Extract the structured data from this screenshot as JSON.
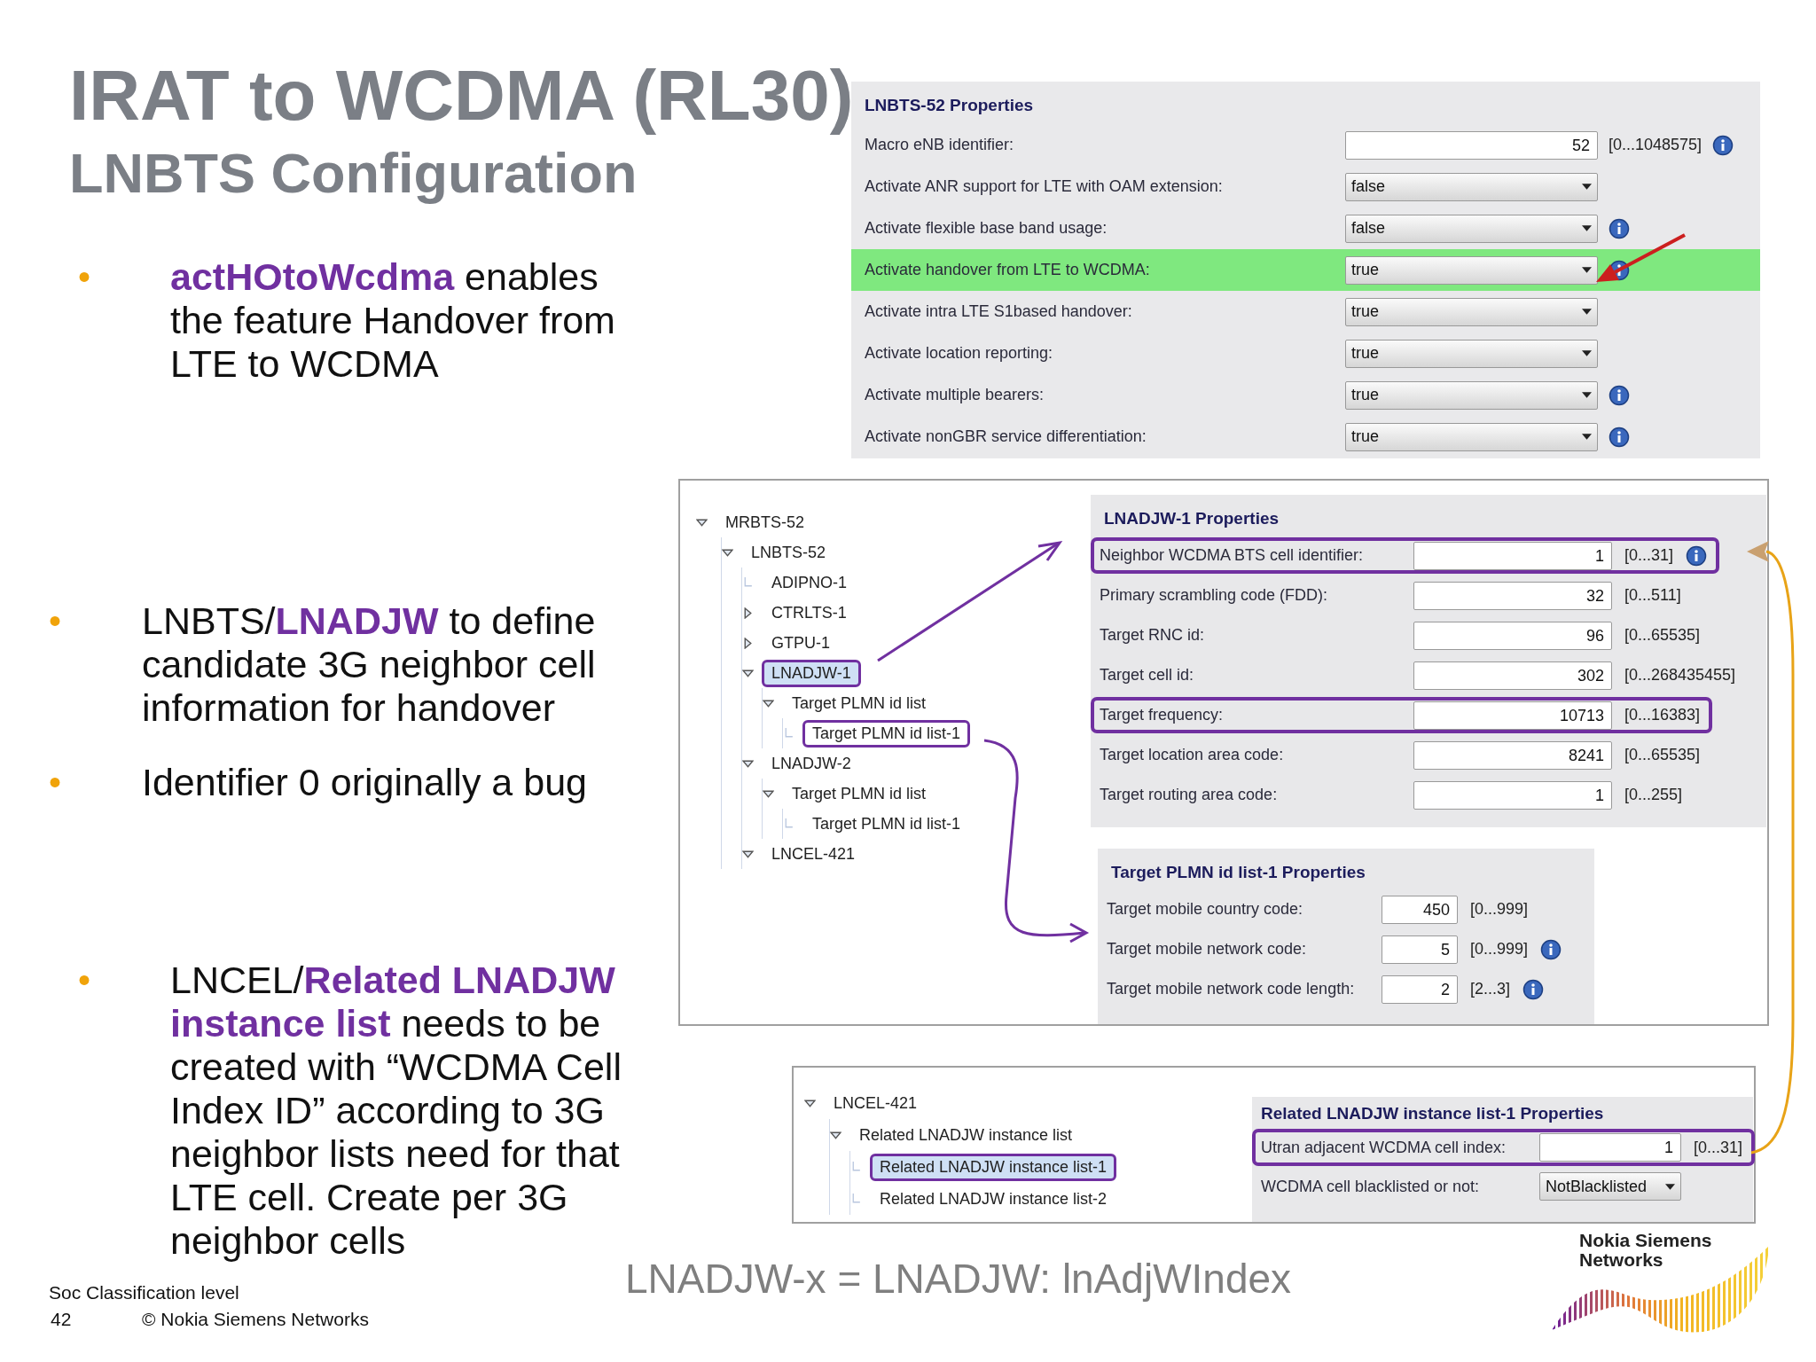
{
  "slide": {
    "title": "IRAT to WCDMA (RL30)",
    "subtitle": "LNBTS Configuration",
    "bullets": [
      {
        "marker": "•",
        "text": "**actHOtoWcdma** enables the feature Handover from LTE to WCDMA"
      },
      {
        "marker": "•",
        "text": "LNBTS/**LNADJW** to define candidate 3G neighbor cell information for handover"
      },
      {
        "marker": "•",
        "text": "Identifier 0 originally a bug"
      },
      {
        "marker": "•",
        "text": "LNCEL/**Related LNADJW instance list** needs to be created with “WCDMA Cell Index ID” according to 3G neighbor lists need for that LTE cell. Create per 3G neighbor cells"
      }
    ],
    "caption": "LNADJW-x = LNADJW: lnAdjWIndex",
    "footer": {
      "classification": "Soc Classification level",
      "page": "42",
      "copyright": "© Nokia Siemens Networks"
    },
    "logo": "Nokia Siemens Networks"
  },
  "lnbts_panel": {
    "title": "LNBTS-52 Properties",
    "rows": [
      {
        "label": "Macro eNB identifier:",
        "kind": "text",
        "value": "52",
        "range": "[0...1048575]",
        "info": true,
        "highlighted": false
      },
      {
        "label": "Activate ANR support for LTE with OAM extension:",
        "kind": "select",
        "value": "false",
        "info": false,
        "highlighted": false
      },
      {
        "label": "Activate flexible base band usage:",
        "kind": "select",
        "value": "false",
        "info": true,
        "highlighted": false
      },
      {
        "label": "Activate handover from LTE to WCDMA:",
        "kind": "select",
        "value": "true",
        "info": true,
        "highlighted": true
      },
      {
        "label": "Activate intra LTE S1based handover:",
        "kind": "select",
        "value": "true",
        "info": false,
        "highlighted": false
      },
      {
        "label": "Activate location reporting:",
        "kind": "select",
        "value": "true",
        "info": false,
        "highlighted": false
      },
      {
        "label": "Activate multiple bearers:",
        "kind": "select",
        "value": "true",
        "info": true,
        "highlighted": false
      },
      {
        "label": "Activate nonGBR service differentiation:",
        "kind": "select",
        "value": "true",
        "info": true,
        "highlighted": false
      }
    ]
  },
  "lnadjw_view": {
    "tree": [
      {
        "label": "MRBTS-52",
        "kind": "node",
        "expanded": true,
        "selected": false,
        "outlined": false,
        "children": [
          {
            "label": "LNBTS-52",
            "kind": "node",
            "expanded": true,
            "selected": false,
            "outlined": false,
            "children": [
              {
                "label": "ADIPNO-1",
                "kind": "leaf",
                "selected": false,
                "outlined": false
              },
              {
                "label": "CTRLTS-1",
                "kind": "node",
                "expanded": false,
                "selected": false,
                "outlined": false
              },
              {
                "label": "GTPU-1",
                "kind": "node",
                "expanded": false,
                "selected": false,
                "outlined": false
              },
              {
                "label": "LNADJW-1",
                "kind": "node",
                "expanded": true,
                "selected": true,
                "outlined": true,
                "children": [
                  {
                    "label": "Target PLMN id list",
                    "kind": "node",
                    "expanded": true,
                    "selected": false,
                    "outlined": false,
                    "children": [
                      {
                        "label": "Target PLMN id list-1",
                        "kind": "leaf",
                        "selected": false,
                        "outlined": true
                      }
                    ]
                  }
                ]
              },
              {
                "label": "LNADJW-2",
                "kind": "node",
                "expanded": true,
                "selected": false,
                "outlined": false,
                "children": [
                  {
                    "label": "Target PLMN id list",
                    "kind": "node",
                    "expanded": true,
                    "selected": false,
                    "outlined": false,
                    "children": [
                      {
                        "label": "Target PLMN id list-1",
                        "kind": "leaf",
                        "selected": false,
                        "outlined": false
                      }
                    ]
                  }
                ]
              },
              {
                "label": "LNCEL-421",
                "kind": "node",
                "expanded": true,
                "selected": false,
                "outlined": false
              }
            ]
          }
        ]
      }
    ],
    "properties": {
      "title": "LNADJW-1 Properties",
      "rows": [
        {
          "label": "Neighbor WCDMA BTS cell identifier:",
          "kind": "text",
          "value": "1",
          "range": "[0...31]",
          "info": true,
          "outlined": true
        },
        {
          "label": "Primary scrambling code (FDD):",
          "kind": "text",
          "value": "32",
          "range": "[0...511]",
          "info": false,
          "outlined": false
        },
        {
          "label": "Target RNC id:",
          "kind": "text",
          "value": "96",
          "range": "[0...65535]",
          "info": false,
          "outlined": false
        },
        {
          "label": "Target cell id:",
          "kind": "text",
          "value": "302",
          "range": "[0...268435455]",
          "info": false,
          "outlined": false
        },
        {
          "label": "Target frequency:",
          "kind": "text",
          "value": "10713",
          "range": "[0...16383]",
          "info": false,
          "outlined": true
        },
        {
          "label": "Target location area code:",
          "kind": "text",
          "value": "8241",
          "range": "[0...65535]",
          "info": false,
          "outlined": false
        },
        {
          "label": "Target routing area code:",
          "kind": "text",
          "value": "1",
          "range": "[0...255]",
          "info": false,
          "outlined": false
        }
      ]
    },
    "plmn_properties": {
      "title": "Target PLMN id list-1 Properties",
      "rows": [
        {
          "label": "Target mobile country code:",
          "kind": "text",
          "value": "450",
          "range": "[0...999]",
          "info": false,
          "outlined": false
        },
        {
          "label": "Target mobile network code:",
          "kind": "text",
          "value": "5",
          "range": "[0...999]",
          "info": true,
          "outlined": false
        },
        {
          "label": "Target mobile network code length:",
          "kind": "text",
          "value": "2",
          "range": "[2...3]",
          "info": true,
          "outlined": false
        }
      ]
    }
  },
  "lncel_view": {
    "tree": [
      {
        "label": "LNCEL-421",
        "kind": "node",
        "expanded": true,
        "selected": false,
        "outlined": false,
        "children": [
          {
            "label": "Related LNADJW instance list",
            "kind": "node",
            "expanded": true,
            "selected": false,
            "outlined": false,
            "children": [
              {
                "label": "Related LNADJW instance list-1",
                "kind": "leaf",
                "selected": true,
                "outlined": true
              },
              {
                "label": "Related LNADJW instance list-2",
                "kind": "leaf",
                "selected": false,
                "outlined": false
              }
            ]
          }
        ]
      }
    ],
    "properties": {
      "title": "Related LNADJW instance list-1 Properties",
      "rows": [
        {
          "label": "Utran adjacent WCDMA cell index:",
          "kind": "text",
          "value": "1",
          "range": "[0...31]",
          "info": false,
          "outlined": true
        },
        {
          "label": "WCDMA cell blacklisted or not:",
          "kind": "select",
          "value": "NotBlacklisted",
          "info": false,
          "outlined": false
        }
      ]
    }
  }
}
